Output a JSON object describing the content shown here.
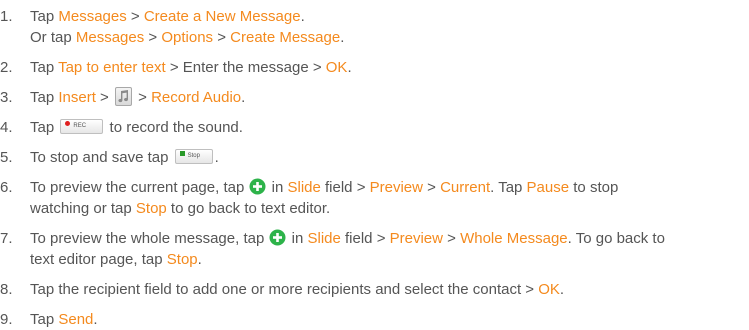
{
  "steps": [
    {
      "num": "1.",
      "line1": {
        "t1": "Tap ",
        "h1": "Messages",
        "t2": " > ",
        "h2": "Create a New Message",
        "t3": "."
      },
      "line2": {
        "t1": "Or tap ",
        "h1": "Messages",
        "t2": " > ",
        "h2": "Options",
        "t3": " > ",
        "h3": "Create Message",
        "t4": "."
      }
    },
    {
      "num": "2.",
      "t1": "Tap ",
      "h1": "Tap to enter text",
      "t2": " > Enter the message > ",
      "h2": "OK",
      "t3": "."
    },
    {
      "num": "3.",
      "t1": "Tap ",
      "h1": "Insert",
      "t2": " > ",
      "t3": " > ",
      "h2": "Record Audio",
      "t4": "."
    },
    {
      "num": "4.",
      "t1": "Tap ",
      "btn": "REC",
      "t2": " to record the sound."
    },
    {
      "num": "5.",
      "t1": "To stop and save tap ",
      "btn": "Stop",
      "t2": "."
    },
    {
      "num": "6.",
      "t1": "To preview the current page, tap ",
      "t2": " in ",
      "h1": "Slide",
      "t3": " field > ",
      "h2": "Preview",
      "t4": " > ",
      "h3": "Current",
      "t5": ". Tap ",
      "h4": "Pause",
      "t6": " to stop watching or tap ",
      "h5": "Stop",
      "t7": " to go back to text editor."
    },
    {
      "num": "7.",
      "t1": "To preview the whole message, tap ",
      "t2": " in ",
      "h1": "Slide",
      "t3": " field > ",
      "h2": "Preview",
      "t4": " > ",
      "h3": "Whole Message",
      "t5": ". To go back to text editor page, tap ",
      "h4": "Stop",
      "t6": "."
    },
    {
      "num": "8.",
      "t1": "Tap the recipient field to add one or more recipients and select the contact > ",
      "h1": "OK",
      "t2": "."
    },
    {
      "num": "9.",
      "t1": "Tap ",
      "h1": "Send",
      "t2": "."
    }
  ],
  "icons": {
    "music": "music-note-icon",
    "plus": "plus-circle-icon",
    "rec_dot": "record-dot-icon",
    "stop_square": "stop-square-icon"
  },
  "colors": {
    "text": "#555555",
    "highlight": "#f48a1e",
    "plus_icon": "#2db34a"
  }
}
